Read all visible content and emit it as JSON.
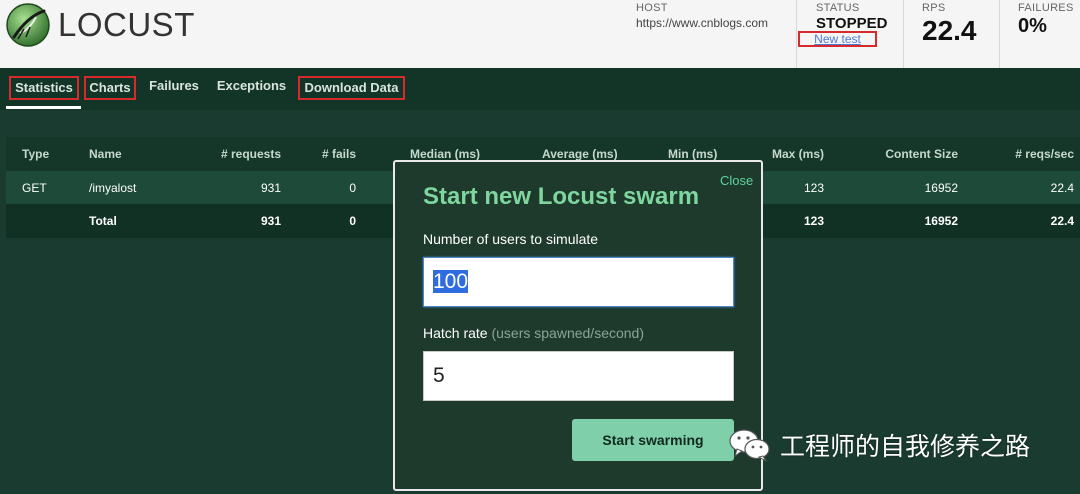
{
  "header": {
    "logo_text": "LOCUST",
    "host_label": "HOST",
    "host_value": "https://www.cnblogs.com",
    "status_label": "STATUS",
    "status_value": "STOPPED",
    "new_test_label": "New test",
    "rps_label": "RPS",
    "rps_value": "22.4",
    "failures_label": "FAILURES",
    "failures_value": "0%"
  },
  "tabs": [
    {
      "label": "Statistics",
      "active": true
    },
    {
      "label": "Charts"
    },
    {
      "label": "Failures"
    },
    {
      "label": "Exceptions"
    },
    {
      "label": "Download Data"
    }
  ],
  "table": {
    "columns": [
      "Type",
      "Name",
      "# requests",
      "# fails",
      "Median (ms)",
      "Average (ms)",
      "Min (ms)",
      "Max (ms)",
      "Content Size",
      "# reqs/sec"
    ],
    "rows": [
      {
        "type": "GET",
        "name": "/imyalost",
        "requests": "931",
        "fails": "0",
        "max": "123",
        "content_size": "16952",
        "reqs_sec": "22.4"
      },
      {
        "type": "",
        "name": "Total",
        "requests": "931",
        "fails": "0",
        "max": "123",
        "content_size": "16952",
        "reqs_sec": "22.4"
      }
    ]
  },
  "modal": {
    "close_label": "Close",
    "title": "Start new Locust swarm",
    "users_label": "Number of users to simulate",
    "users_value": "100",
    "hatch_label": "Hatch rate",
    "hatch_hint": "(users spawned/second)",
    "hatch_value": "5",
    "submit_label": "Start swarming"
  },
  "watermark": {
    "icon": "wechat-icon",
    "text": "工程师的自我修养之路"
  },
  "colors": {
    "header_bg": "#f5f5f5",
    "page_bg": "#1a3b2f",
    "accent_green": "#7fd69f",
    "annotation_red": "#d8292c"
  }
}
